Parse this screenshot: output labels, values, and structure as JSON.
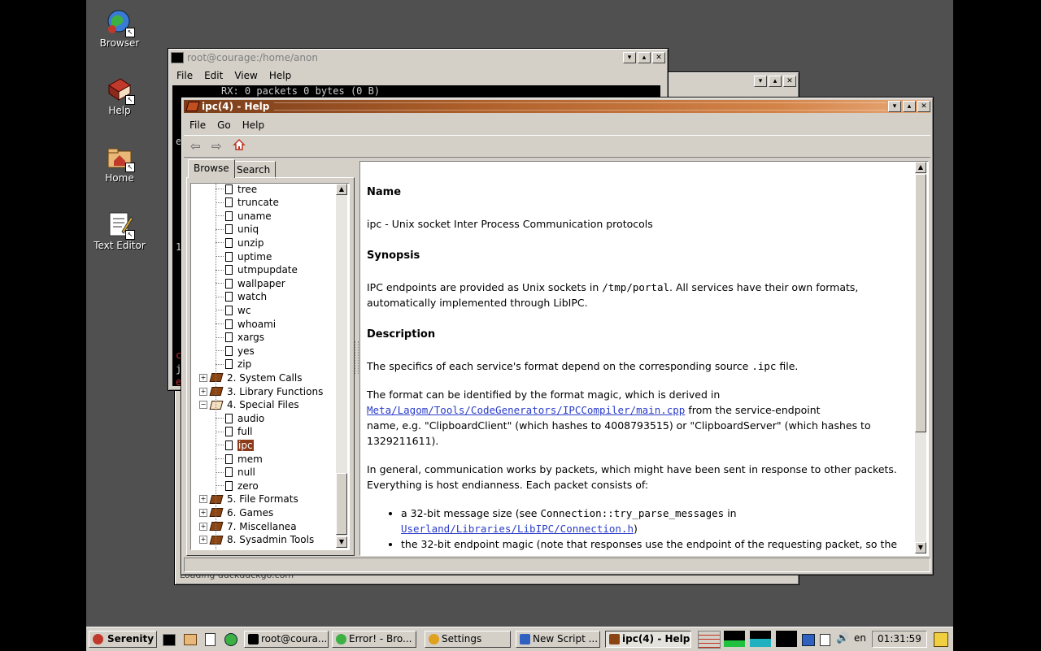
{
  "desktop": {
    "icons": [
      {
        "label": "Browser",
        "icon": "globe-icon"
      },
      {
        "label": "Help",
        "icon": "book-icon"
      },
      {
        "label": "Home",
        "icon": "home-folder-icon"
      },
      {
        "label": "Text Editor",
        "icon": "text-editor-icon"
      }
    ]
  },
  "terminal": {
    "title": "root@courage:/home/anon",
    "menu": [
      "File",
      "Edit",
      "View",
      "Help"
    ],
    "line": "RX: 0 packets 0 bytes (0 B)",
    "side_chars": [
      "e",
      "1",
      "c",
      "j",
      "e"
    ]
  },
  "browser_window": {
    "status": "Loading duckduckgo.com"
  },
  "help": {
    "title": "ipc(4) - Help",
    "menu": [
      "File",
      "Go",
      "Help"
    ],
    "tabs": [
      "Browse",
      "Search"
    ],
    "tree": [
      {
        "label": "tree",
        "kind": "file"
      },
      {
        "label": "truncate",
        "kind": "file"
      },
      {
        "label": "uname",
        "kind": "file"
      },
      {
        "label": "uniq",
        "kind": "file"
      },
      {
        "label": "unzip",
        "kind": "file"
      },
      {
        "label": "uptime",
        "kind": "file"
      },
      {
        "label": "utmpupdate",
        "kind": "file"
      },
      {
        "label": "wallpaper",
        "kind": "file"
      },
      {
        "label": "watch",
        "kind": "file"
      },
      {
        "label": "wc",
        "kind": "file"
      },
      {
        "label": "whoami",
        "kind": "file"
      },
      {
        "label": "xargs",
        "kind": "file"
      },
      {
        "label": "yes",
        "kind": "file"
      },
      {
        "label": "zip",
        "kind": "file"
      },
      {
        "label": "2. System Calls",
        "kind": "book"
      },
      {
        "label": "3. Library Functions",
        "kind": "book"
      },
      {
        "label": "4. Special Files",
        "kind": "book-open"
      },
      {
        "label": "audio",
        "kind": "file"
      },
      {
        "label": "full",
        "kind": "file"
      },
      {
        "label": "ipc",
        "kind": "file",
        "selected": true
      },
      {
        "label": "mem",
        "kind": "file"
      },
      {
        "label": "null",
        "kind": "file"
      },
      {
        "label": "zero",
        "kind": "file"
      },
      {
        "label": "5. File Formats",
        "kind": "book"
      },
      {
        "label": "6. Games",
        "kind": "book"
      },
      {
        "label": "7. Miscellanea",
        "kind": "book"
      },
      {
        "label": "8. Sysadmin Tools",
        "kind": "book"
      }
    ],
    "doc": {
      "h_name": "Name",
      "name_text": "ipc - Unix socket Inter Process Communication protocols",
      "h_synopsis": "Synopsis",
      "syn_1": "IPC endpoints are provided as Unix sockets in ",
      "syn_code": "/tmp/portal",
      "syn_2": ". All services have their own formats,",
      "syn_3": "automatically implemented through LibIPC.",
      "h_description": "Description",
      "desc_1a": "The specifics of each service's format depend on the corresponding source ",
      "desc_1code": ".ipc",
      "desc_1b": " file.",
      "desc_2a": "The format can be identified by the format magic, which is derived in",
      "desc_2link": "Meta/Lagom/Tools/CodeGenerators/IPCCompiler/main.cpp",
      "desc_2b": " from the service-endpoint",
      "desc_2c": "name, e.g. \"ClipboardClient\" (which hashes to 4008793515) or \"ClipboardServer\" (which hashes to",
      "desc_2d": "1329211611).",
      "desc_3a": "In general, communication works by packets, which might have been sent in response to other packets.",
      "desc_3b": "Everything is host endianness. Each packet consists of:",
      "li1a": "a 32-bit message size (see ",
      "li1code": "Connection::try_parse_messages",
      "li1b": " in",
      "li1link": "Userland/Libraries/LibIPC/Connection.h",
      "li1c": ")",
      "li2": "the 32-bit endpoint magic (note that responses use the endpoint of the requesting packet, so the"
    }
  },
  "taskbar": {
    "start": "Serenity",
    "buttons": [
      {
        "label": "root@coura...",
        "icon": "terminal-icon"
      },
      {
        "label": "Error! - Bro...",
        "icon": "globe-icon"
      },
      {
        "label": "Settings",
        "icon": "settings-icon"
      },
      {
        "label": "New Script ...",
        "icon": "script-icon"
      },
      {
        "label": "ipc(4) - Help",
        "icon": "book-icon",
        "active": true
      }
    ],
    "keymap": "en",
    "clock": "01:31:59"
  },
  "colors": {
    "desktop": "#505050",
    "title_active_start": "#7a3d1a",
    "title_active_end": "#e8a878",
    "link": "#2a3cc8",
    "chrome": "#d4d0c8"
  }
}
